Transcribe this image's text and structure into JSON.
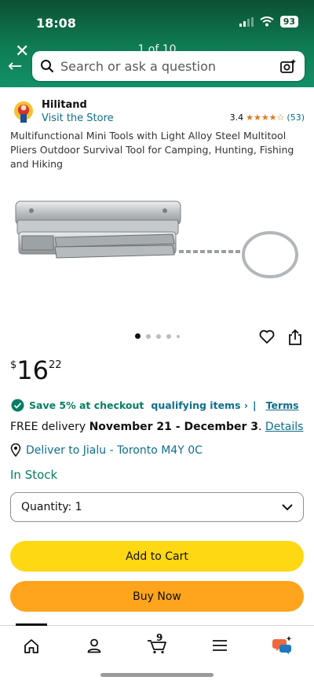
{
  "status_bar": {
    "time": "18:08",
    "battery": "93"
  },
  "header": {
    "page_indicator": "1 of 10"
  },
  "search": {
    "placeholder": "Search or ask a question"
  },
  "brand": {
    "name": "Hilitand",
    "visit_store": "Visit the Store"
  },
  "rating": {
    "value": "3.4",
    "stars_fraction": 0.68,
    "count": "(53)"
  },
  "product": {
    "title": "Multifunctional Mini Tools with Light Alloy Steel Multitool Pliers Outdoor Survival Tool for Camping, Hunting, Fishing and Hiking",
    "image_count": 5,
    "active_image": 0
  },
  "price": {
    "currency": "$",
    "whole": "16",
    "fraction": "22"
  },
  "savings": {
    "text": "Save 5% at checkout",
    "qualifying": "qualifying items ›",
    "separator": "|",
    "terms": "Terms"
  },
  "delivery": {
    "prefix": "FREE delivery ",
    "dates": "November 21 - December 3",
    "suffix": ". ",
    "details": "Details"
  },
  "location": {
    "text": "Deliver to Jialu - Toronto M4Y 0C"
  },
  "stock": {
    "status": "In Stock"
  },
  "quantity": {
    "label": "Quantity: 1"
  },
  "buttons": {
    "add_to_cart": "Add to Cart",
    "buy_now": "Buy Now"
  },
  "tabbar": {
    "cart_count": "9",
    "active_tab": "home"
  },
  "colors": {
    "header_green": "#0f7d55",
    "link": "#0f6e8c",
    "success": "#067d62",
    "add_to_cart": "#ffd814",
    "buy_now": "#ffa41c"
  }
}
